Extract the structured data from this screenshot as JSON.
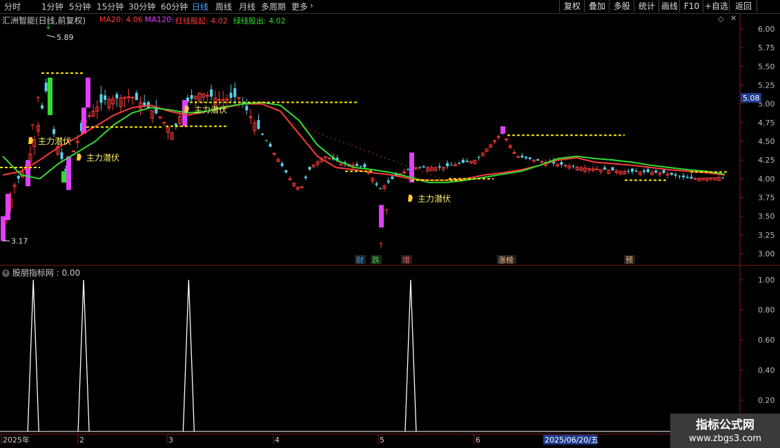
{
  "toolbar": {
    "periods": [
      "分时",
      "1分钟",
      "5分钟",
      "15分钟",
      "30分钟",
      "60分钟",
      "日线",
      "周线",
      "月线",
      "多周期",
      "更多"
    ],
    "active_period": "日线",
    "buttons": [
      "复权",
      "叠加",
      "多股",
      "统计",
      "画线",
      "F10",
      "+自选",
      "返回"
    ]
  },
  "main_panel": {
    "stock_label": "汇洲智能(日线,前复权)",
    "indicators": [
      {
        "text": "MA20: 4.06",
        "color": "#ff3b3b"
      },
      {
        "text": "MA120:",
        "color": "#e040fb"
      },
      {
        "text": "红线股起: 4.02",
        "color": "#ff3b3b"
      },
      {
        "text": "绿线股出: 4.02",
        "color": "#33dd33"
      }
    ],
    "current_price": "5.08",
    "high_label": "5.89",
    "low_label": "3.17",
    "signal_text": "主力潜伏",
    "event_labels": [
      "财",
      "跌",
      "增",
      "涨榜",
      "预"
    ]
  },
  "sub_panel": {
    "title": "股朋指标网 : 0.00"
  },
  "date_axis": [
    "2025年",
    "2",
    "3",
    "4",
    "5",
    "6",
    "2025/06/20/五"
  ],
  "watermark": {
    "line1": "指标公式网",
    "line2": "www.zbgs3.com"
  },
  "chart_data": [
    {
      "type": "candlestick",
      "title": "汇洲智能(日线,前复权)",
      "ylim": [
        2.9,
        6.1
      ],
      "yticks": [
        "6.00",
        "5.75",
        "5.50",
        "5.25",
        "5.00",
        "4.75",
        "4.50",
        "4.25",
        "4.00",
        "3.75",
        "3.50",
        "3.25",
        "3.00"
      ],
      "x_labels": [
        "2025年",
        "2",
        "3",
        "4",
        "5",
        "6"
      ],
      "overlay_series": [
        {
          "name": "红线股起",
          "color": "#ff3b3b",
          "values": [
            4.05,
            4.1,
            4.25,
            4.42,
            4.55,
            4.7,
            4.85,
            4.95,
            4.98,
            4.9,
            4.85,
            4.9,
            4.95,
            5.0,
            5.0,
            4.9,
            4.6,
            4.3,
            4.15,
            4.12,
            4.08,
            4.05,
            4.0,
            3.98,
            3.98,
            4.0,
            4.05,
            4.08,
            4.12,
            4.18,
            4.25,
            4.28,
            4.22,
            4.2,
            4.18,
            4.15,
            4.12,
            4.1,
            4.08,
            4.05
          ]
        },
        {
          "name": "绿线股出",
          "color": "#33dd33",
          "values": [
            4.3,
            4.05,
            4.0,
            4.2,
            4.35,
            4.5,
            4.72,
            4.88,
            4.95,
            4.92,
            4.88,
            4.9,
            4.96,
            5.0,
            5.02,
            4.98,
            4.78,
            4.45,
            4.25,
            4.15,
            4.12,
            4.08,
            4.02,
            3.95,
            3.95,
            3.98,
            4.02,
            4.06,
            4.1,
            4.18,
            4.27,
            4.3,
            4.27,
            4.25,
            4.22,
            4.18,
            4.15,
            4.12,
            4.1,
            4.06
          ]
        }
      ],
      "annotations": [
        "5.89",
        "3.17",
        "主力潜伏",
        "财",
        "跌",
        "增",
        "涨榜",
        "预"
      ]
    },
    {
      "type": "line",
      "title": "股朋指标网 : 0.00",
      "ylim": [
        0,
        1.05
      ],
      "yticks": [
        "1.00",
        "0.80",
        "0.60",
        "0.40",
        "0.20"
      ],
      "spikes_at_x_fraction": [
        0.045,
        0.113,
        0.255,
        0.555
      ],
      "spike_value": 1.0
    }
  ]
}
